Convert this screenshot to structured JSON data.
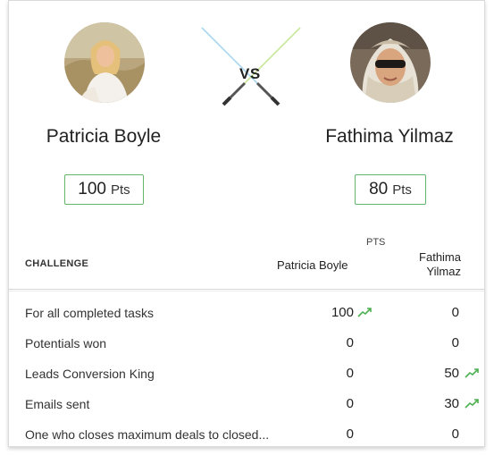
{
  "players": [
    {
      "name": "Patricia Boyle",
      "points": "100",
      "points_unit": "Pts"
    },
    {
      "name": "Fathima Yilmaz",
      "points": "80",
      "points_unit": "Pts"
    }
  ],
  "vs_label": "VS",
  "table": {
    "pts_header": "PTS",
    "challenge_header": "CHALLENGE",
    "player1_header": "Patricia Boyle",
    "player2_header_line1": "Fathima",
    "player2_header_line2": "Yilmaz",
    "rows": [
      {
        "challenge": "For all completed tasks",
        "p1": "100",
        "p2": "0",
        "p1_trend": true,
        "p2_trend": false
      },
      {
        "challenge": "Potentials won",
        "p1": "0",
        "p2": "0",
        "p1_trend": false,
        "p2_trend": false
      },
      {
        "challenge": "Leads Conversion King",
        "p1": "0",
        "p2": "50",
        "p1_trend": false,
        "p2_trend": true
      },
      {
        "challenge": "Emails sent",
        "p1": "0",
        "p2": "30",
        "p1_trend": false,
        "p2_trend": true
      },
      {
        "challenge": "One who closes maximum deals to closed...",
        "p1": "0",
        "p2": "0",
        "p1_trend": false,
        "p2_trend": false
      }
    ]
  },
  "colors": {
    "accent_green": "#63b56a",
    "trend_green": "#4caf50",
    "saber_blue": "#a8d8f0",
    "saber_green": "#c9e89a"
  },
  "icons": [
    "trend-up-icon",
    "lightsaber-icon"
  ]
}
